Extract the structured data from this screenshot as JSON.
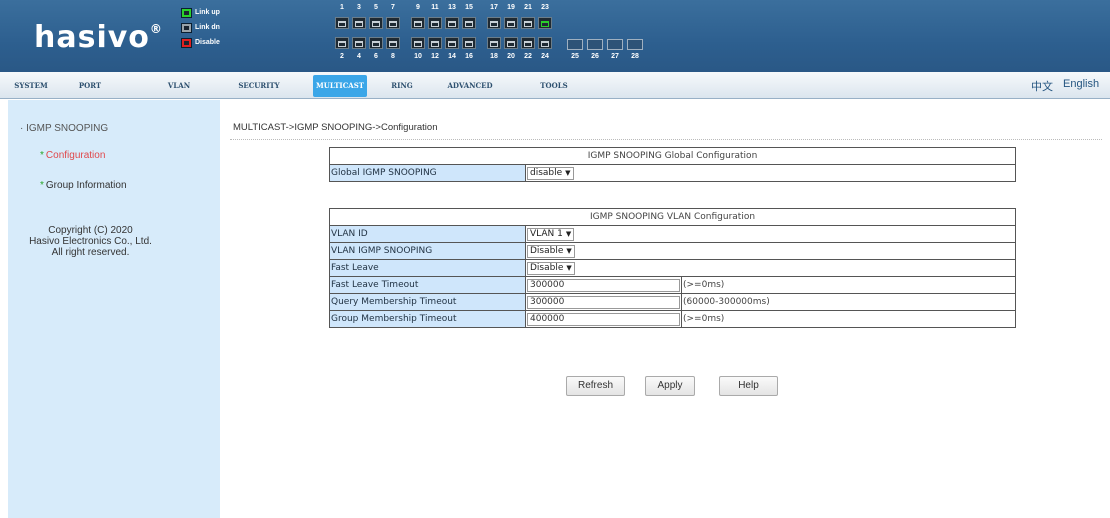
{
  "brand": {
    "logo": "hasivo",
    "reg": "®"
  },
  "legend": [
    {
      "label": "Link up",
      "color": "#2bd12b"
    },
    {
      "label": "Link dn",
      "color": "#9aa3a9"
    },
    {
      "label": "Disable",
      "color": "#e02020"
    }
  ],
  "ports": {
    "top_numbers": [
      "1",
      "3",
      "5",
      "7",
      "9",
      "11",
      "13",
      "15",
      "17",
      "19",
      "21",
      "23"
    ],
    "bottom_numbers": [
      "2",
      "4",
      "6",
      "8",
      "10",
      "12",
      "14",
      "16",
      "18",
      "20",
      "22",
      "24"
    ],
    "sfp_numbers": [
      "25",
      "26",
      "27",
      "28"
    ],
    "link_up": [
      "23"
    ]
  },
  "nav": {
    "tabs": [
      "SYSTEM",
      "PORT",
      "VLAN",
      "SECURITY",
      "MULTICAST",
      "RING",
      "ADVANCED",
      "TOOLS"
    ],
    "active": "MULTICAST",
    "lang_cn": "中文",
    "lang_en": "English"
  },
  "sidebar": {
    "section": "IGMP SNOOPING",
    "items": [
      {
        "label": "Configuration",
        "selected": true
      },
      {
        "label": "Group Information",
        "selected": false
      }
    ],
    "copyright": [
      "Copyright (C) 2020",
      "Hasivo Electronics Co., Ltd.",
      "All right reserved."
    ]
  },
  "breadcrumb": "MULTICAST->IGMP SNOOPING->Configuration",
  "global": {
    "title": "IGMP SNOOPING Global Configuration",
    "label": "Global IGMP SNOOPING",
    "value": "disable"
  },
  "vlan": {
    "title": "IGMP SNOOPING VLAN Configuration",
    "rows": [
      {
        "label": "VLAN ID",
        "type": "select",
        "value": "VLAN 1"
      },
      {
        "label": "VLAN IGMP SNOOPING",
        "type": "select",
        "value": "Disable"
      },
      {
        "label": "Fast Leave",
        "type": "select",
        "value": "Disable"
      },
      {
        "label": "Fast Leave Timeout",
        "type": "text",
        "value": "300000",
        "hint": "(>=0ms)"
      },
      {
        "label": "Query Membership Timeout",
        "type": "text",
        "value": "300000",
        "hint": "(60000-300000ms)"
      },
      {
        "label": "Group Membership Timeout",
        "type": "text",
        "value": "400000",
        "hint": "(>=0ms)"
      }
    ]
  },
  "buttons": {
    "refresh": "Refresh",
    "apply": "Apply",
    "help": "Help"
  }
}
